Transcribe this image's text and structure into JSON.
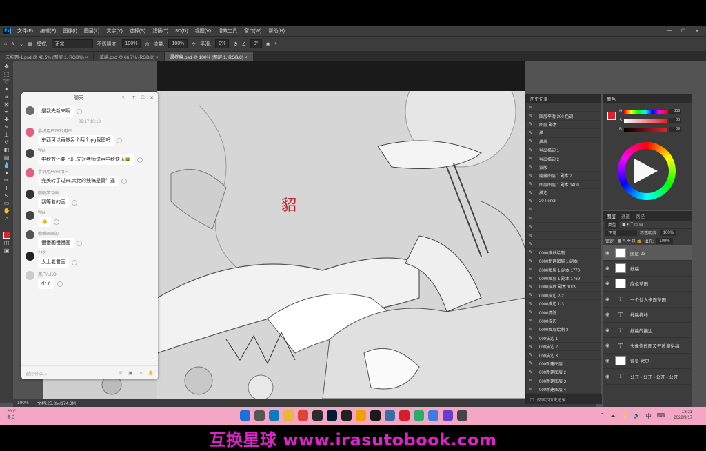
{
  "app": {
    "logo": "Ps",
    "menus": [
      "文件(F)",
      "编辑(E)",
      "图像(I)",
      "图层(L)",
      "文字(Y)",
      "选择(S)",
      "滤镜(T)",
      "3D(D)",
      "视图(V)",
      "增效工具",
      "窗口(W)",
      "帮助(H)"
    ],
    "window_buttons": [
      "—",
      "☐",
      "✕"
    ]
  },
  "options_bar": {
    "mode_label": "模式:",
    "mode_value": "正常",
    "opacity_label": "不透明度:",
    "opacity_value": "100%",
    "flow_label": "流量:",
    "flow_value": "100%",
    "smooth_label": "平滑:",
    "smooth_value": "0%",
    "angle_value": "0°"
  },
  "doc_tabs": [
    {
      "label": "未标题-1.psd @ 48.5% (图层 1, RGB/8) ×",
      "active": false
    },
    {
      "label": "草稿.psd @ 66.7% (RGB/8) ×",
      "active": false
    },
    {
      "label": "最终稿.psd @ 100% (图层 1, RGB/8) ×",
      "active": true
    }
  ],
  "status": {
    "zoom": "100%",
    "doc": "文档:25.3M/174.3M"
  },
  "chat": {
    "title": "聊天",
    "header_icons": [
      "↻",
      "⊤",
      "□",
      "✕"
    ],
    "messages": [
      {
        "name": "",
        "text": "是我先新来啊",
        "avatar_color": "#6b6b6b"
      },
      {
        "time": "09:17 10:18"
      },
      {
        "name": "手机用户7877用户",
        "text": "东西可以再做另个两个jpg截图吗",
        "avatar_color": "#e06080"
      },
      {
        "name": "Wei",
        "text": "中秋节还要上班,先对老师说声中秋快乐😄",
        "avatar_color": "#444"
      },
      {
        "name": "手机用户/#//用户",
        "text": "完美转了过来,大佬的线稿是真牛逼",
        "avatar_color": "#e06080"
      },
      {
        "name": "刚刚学习画",
        "text": "我等着的画",
        "avatar_color": "#333"
      },
      {
        "name": "Wei",
        "text": "👍",
        "avatar_color": "#444"
      },
      {
        "name": "啾啾画画的",
        "text": "慢慢画慢慢画",
        "avatar_color": "#555"
      },
      {
        "name": "ZZZ",
        "text": "太上老君画",
        "avatar_color": "#222"
      },
      {
        "name": "用户/UKO",
        "text": "小了",
        "avatar_color": "#cccccc"
      }
    ],
    "input_placeholder": "说点什么...",
    "input_icons": [
      "☺",
      "▣",
      "⋯",
      "✋"
    ]
  },
  "stamp": "貂",
  "history": {
    "title": "历史记录",
    "items": [
      "",
      "图层平滑 300 色调",
      "图层 副本",
      "描",
      "描线",
      "导出描边 1",
      "导出描边 2",
      "蒙版",
      "隐藏图层 1 副本 2",
      "图层图层 1 副本 1400",
      "描边",
      "20 Pencil",
      "",
      "",
      "",
      "",
      "",
      "0000描线绘制",
      "0000新建图层 1 副本",
      "0000图层 1 副本 1770",
      "0000图层 1 副本 1769",
      "0000描线 副本 1009",
      "0000描边 2-2",
      "0000描边 1-3",
      "0000清除",
      "0000描边",
      "0000图层绘制 3",
      "000描边 1",
      "000描边 2",
      "000描边 3",
      "000新建图层 1",
      "000新建图层 2",
      "000新建图层 3",
      "000新建图层 4"
    ],
    "footer": "仅显示历史记录"
  },
  "color_panel": {
    "title": "颜色",
    "fg_color": "#e3202a",
    "slider_labels": [
      "H",
      "S",
      "B"
    ],
    "slider_values": [
      "356",
      "86",
      "89"
    ]
  },
  "layers": {
    "tabs": [
      "图层",
      "通道",
      "路径"
    ],
    "active_tab": "图层",
    "kind_label": "类型",
    "blend_mode": "正常",
    "opacity_label": "不透明度:",
    "opacity_value": "100%",
    "lock_label": "锁定:",
    "fill_label": "填充:",
    "fill_value": "100%",
    "items": [
      {
        "name": "图层 23",
        "type": "pixel",
        "selected": true
      },
      {
        "name": "线稿",
        "type": "pixel",
        "selected": false
      },
      {
        "name": "底色草图",
        "type": "pixel",
        "selected": false
      },
      {
        "name": "一个仙人卡面草图",
        "type": "text",
        "selected": false
      },
      {
        "name": "线稿描线",
        "type": "text",
        "selected": false
      },
      {
        "name": "线稿的描边",
        "type": "text",
        "selected": false
      },
      {
        "name": "头像修改图及开放演讲稿",
        "type": "text",
        "selected": false
      },
      {
        "name": "背景 拷贝",
        "type": "pixel",
        "selected": false
      },
      {
        "name": "公开 - 公开 - 公开 - 公开",
        "type": "text",
        "selected": false
      }
    ],
    "footer_icons": [
      "⛓",
      "fx",
      "◐",
      "◑",
      "▭",
      "+",
      "🗑"
    ]
  },
  "taskbar": {
    "weather_temp": "20°C",
    "weather_desc": "多云",
    "apps": [
      {
        "icon": "win",
        "color": "#1e6fd9"
      },
      {
        "icon": "search",
        "color": "#555"
      },
      {
        "icon": "edge",
        "color": "#0f7bbf"
      },
      {
        "icon": "folder",
        "color": "#e8b83a"
      },
      {
        "icon": "chrome",
        "color": "#dd4433"
      },
      {
        "icon": "clip",
        "color": "#2d2d2d"
      },
      {
        "icon": "Ps",
        "color": "#001d34"
      },
      {
        "icon": "LR",
        "color": "#222"
      },
      {
        "icon": "LN",
        "color": "#f0a000"
      },
      {
        "icon": "app1",
        "color": "#1a1a1a"
      },
      {
        "icon": "app2",
        "color": "#3a6ea5"
      },
      {
        "icon": "W",
        "color": "#d21f2a"
      },
      {
        "icon": "wechat",
        "color": "#2aae67"
      },
      {
        "icon": "app3",
        "color": "#3d7de0"
      },
      {
        "icon": "app4",
        "color": "#6a3ec8"
      },
      {
        "icon": "app5",
        "color": "#444"
      }
    ],
    "tray_icons": [
      "⌃",
      "☁",
      "⚡",
      "🔊",
      "中",
      "⌨"
    ],
    "time": "13:21",
    "date": "2022/9/17"
  },
  "banner": "互换星球 www.irasutobook.com"
}
